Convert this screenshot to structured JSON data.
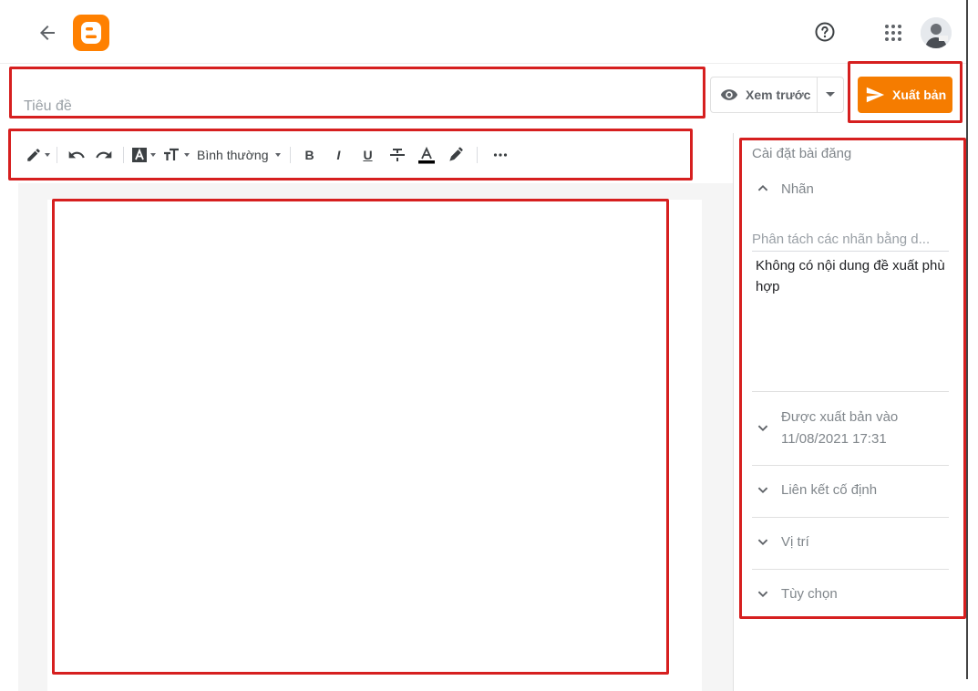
{
  "header": {
    "back_icon": "arrow-back-icon",
    "logo": "blogger-logo",
    "help_icon": "help-circle-icon",
    "apps_icon": "apps-grid-icon",
    "avatar": "user-avatar"
  },
  "editor": {
    "title_placeholder": "Tiêu đề",
    "preview_label": "Xem trước",
    "publish_label": "Xuất bản"
  },
  "toolbar": {
    "items": [
      "pencil-icon",
      "undo-icon",
      "redo-icon",
      "text-background-icon",
      "font-size-icon",
      "bold-icon",
      "italic-icon",
      "underline-icon",
      "strikethrough-icon",
      "text-color-icon",
      "highlight-icon",
      "more-icon"
    ],
    "paragraph_style": "Bình thường",
    "bold": "B",
    "italic": "I",
    "underline": "U"
  },
  "sidebar": {
    "title": "Cài đặt bài đăng",
    "labels_header": "Nhãn",
    "labels_placeholder": "Phân tách các nhãn bằng d...",
    "labels_suggestion": "Không có nội dung đề xuất phù hợp",
    "published_label": "Được xuất bản vào",
    "published_date": "11/08/2021 17:31",
    "permalink_label": "Liên kết cố định",
    "location_label": "Vị trí",
    "options_label": "Tùy chọn"
  },
  "colors": {
    "accent": "#f57c00",
    "annotation": "#d61f1f"
  }
}
